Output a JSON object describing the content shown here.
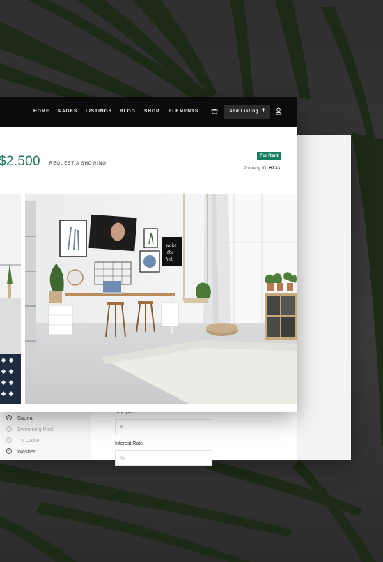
{
  "nav": {
    "items": [
      "HOME",
      "PAGES",
      "LISTINGS",
      "BLOG",
      "SHOP",
      "ELEMENTS"
    ],
    "add_listing": "Add Listing",
    "add_icon": "+"
  },
  "listing": {
    "price": "$2.500",
    "request_label": "REQUEST A SHOWING",
    "status_badge": "For Rent",
    "property_id_label": "Property ID:",
    "property_id_value": "HZ33"
  },
  "features": [
    {
      "label": "Sauna",
      "checked": true
    },
    {
      "label": "Swimming Pool",
      "checked": false
    },
    {
      "label": "TV Cable",
      "checked": false
    },
    {
      "label": "Washer",
      "checked": true
    }
  ],
  "calculator": {
    "sale_price_label": "Sale price",
    "sale_price_placeholder": "$",
    "interest_rate_label": "Interest Rate",
    "interest_rate_placeholder": "%"
  },
  "colors": {
    "accent": "#1b7a5f",
    "badge": "#1a7f60",
    "navbar": "#0b0b0b"
  }
}
